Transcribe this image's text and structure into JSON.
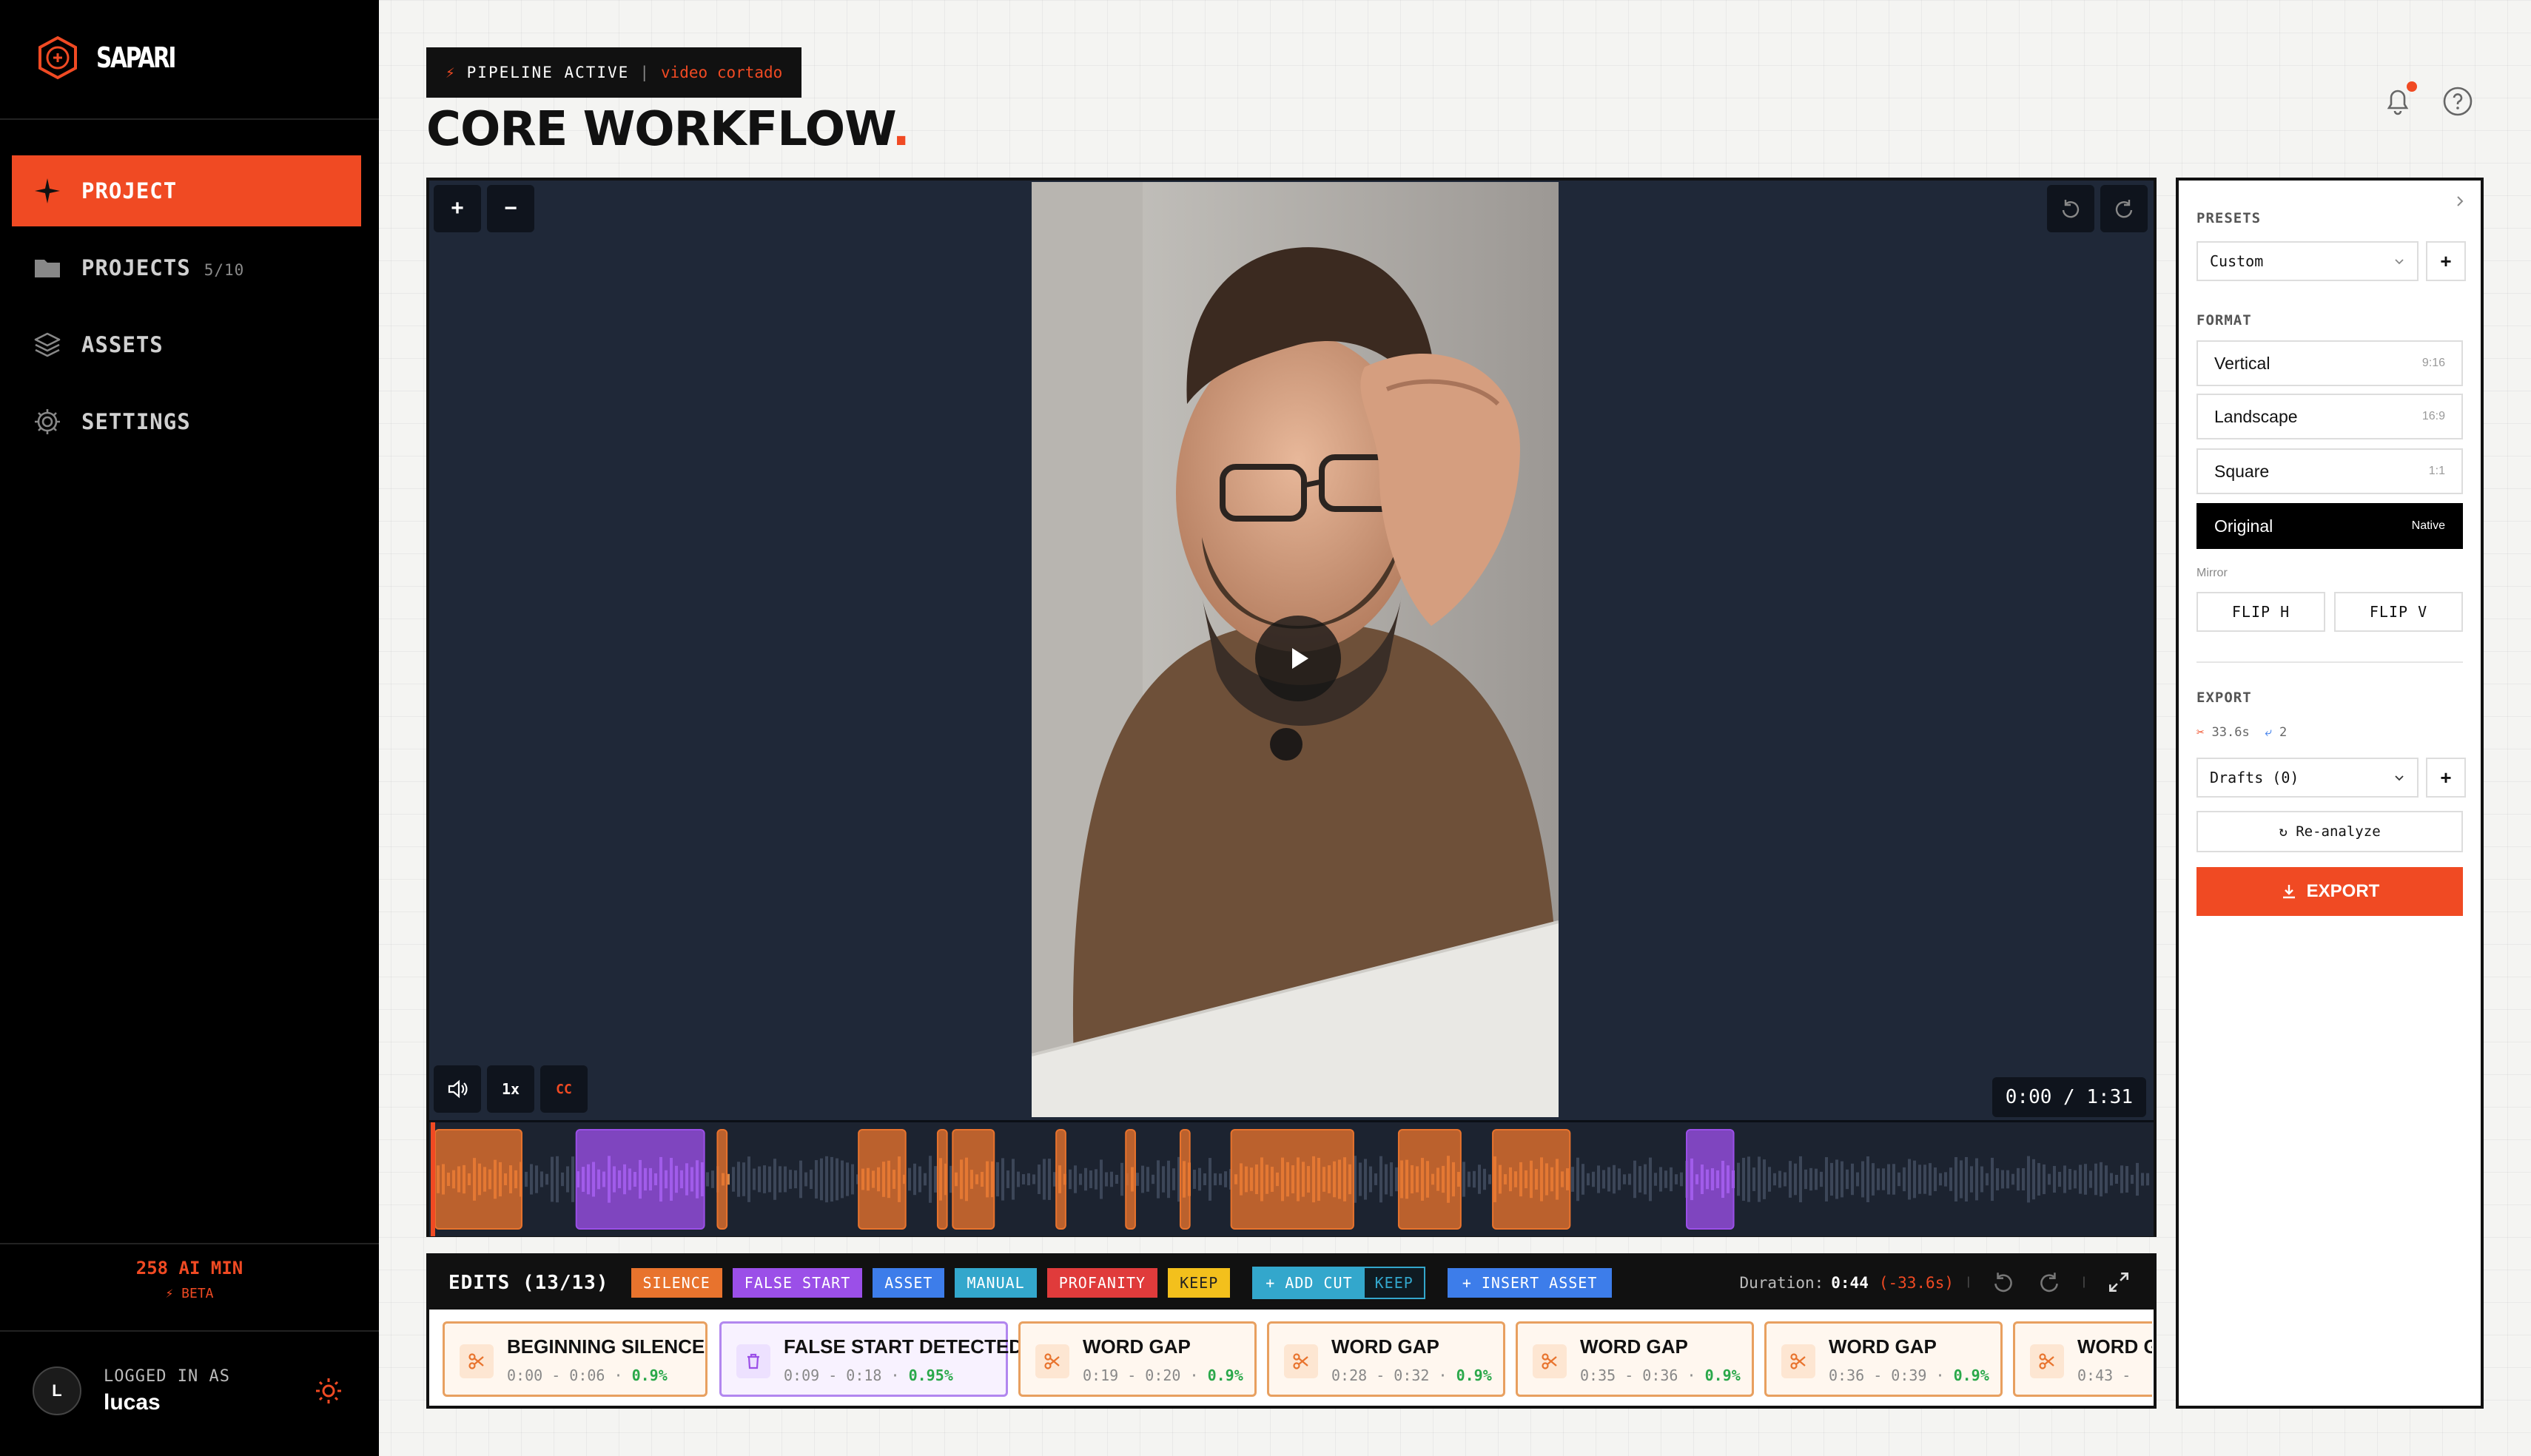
{
  "app": {
    "name": "SAPARI"
  },
  "sidebar": {
    "items": [
      {
        "label": "PROJECT",
        "count": ""
      },
      {
        "label": "PROJECTS",
        "count": "5/10"
      },
      {
        "label": "ASSETS",
        "count": ""
      },
      {
        "label": "SETTINGS",
        "count": ""
      }
    ],
    "credits": "258 AI MIN",
    "beta": "BETA",
    "user": {
      "label": "LOGGED IN AS",
      "name": "lucas",
      "initial": "L"
    }
  },
  "header": {
    "status": "PIPELINE ACTIVE",
    "project": "video cortado",
    "title": "CORE WORKFLOW",
    "title_dot": "."
  },
  "player": {
    "zoom_in": "+",
    "zoom_out": "−",
    "speed": "1x",
    "cc": "CC",
    "current_time": "0:00",
    "total_time": "1:31"
  },
  "edits": {
    "title": "EDITS (13/13)",
    "tags": [
      "SILENCE",
      "FALSE START",
      "ASSET",
      "MANUAL",
      "PROFANITY",
      "KEEP"
    ],
    "add_cut": "+ ADD CUT",
    "keep": "KEEP",
    "insert_asset": "+ INSERT ASSET",
    "duration_label": "Duration:",
    "duration": "0:44",
    "saved": "(-33.6s)",
    "cards": [
      {
        "title": "BEGINNING SILENCE",
        "range": "0:00 - 0:06",
        "pct": "0.9%",
        "kind": "silence"
      },
      {
        "title": "FALSE START DETECTED",
        "range": "0:09 - 0:18",
        "pct": "0.95%",
        "kind": "false-start"
      },
      {
        "title": "WORD GAP",
        "range": "0:19 - 0:20",
        "pct": "0.9%",
        "kind": "silence"
      },
      {
        "title": "WORD GAP",
        "range": "0:28 - 0:32",
        "pct": "0.9%",
        "kind": "silence"
      },
      {
        "title": "WORD GAP",
        "range": "0:35 - 0:36",
        "pct": "0.9%",
        "kind": "silence"
      },
      {
        "title": "WORD GAP",
        "range": "0:36 - 0:39",
        "pct": "0.9%",
        "kind": "silence"
      },
      {
        "title": "WORD GAP",
        "range": "0:43 -",
        "pct": "",
        "kind": "silence"
      }
    ]
  },
  "panel": {
    "presets_label": "PRESETS",
    "preset_value": "Custom",
    "format_label": "FORMAT",
    "formats": [
      {
        "name": "Vertical",
        "ratio": "9:16"
      },
      {
        "name": "Landscape",
        "ratio": "16:9"
      },
      {
        "name": "Square",
        "ratio": "1:1"
      },
      {
        "name": "Original",
        "ratio": "Native"
      }
    ],
    "selected_format": "Original",
    "mirror_label": "Mirror",
    "flip_h": "FLIP H",
    "flip_v": "FLIP V",
    "export_label": "EXPORT",
    "cut_stat": "33.6s",
    "split_stat": "2",
    "drafts": "Drafts (0)",
    "reanalyze": "↻ Re-analyze",
    "export_button": "EXPORT"
  },
  "colors": {
    "accent": "#f04a23",
    "silence": "#e8732d",
    "false_start": "#9b4fe8",
    "asset": "#3d7dea",
    "manual": "#33a7cc",
    "profanity": "#e03b3b",
    "keep": "#f3c01c"
  }
}
